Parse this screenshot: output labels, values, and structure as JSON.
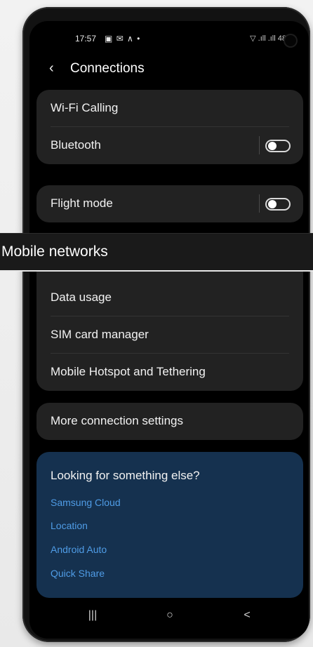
{
  "status_bar": {
    "time": "17:57",
    "left_icons": "▣ ✉ ∧ •",
    "right_icons": "▽ .ıll .ıll 48"
  },
  "header": {
    "back_icon": "chevron-left-icon",
    "title": "Connections"
  },
  "group_1": {
    "wifi_calling": "Wi-Fi Calling",
    "bluetooth": "Bluetooth",
    "bluetooth_on": false
  },
  "group_2": {
    "flight_mode": "Flight mode",
    "flight_mode_on": false
  },
  "banner": {
    "text": "Mobile networks"
  },
  "group_3": {
    "data_usage": "Data usage",
    "sim_card_manager": "SIM card manager",
    "hotspot": "Mobile Hotspot and Tethering"
  },
  "group_4": {
    "more_settings": "More connection settings"
  },
  "looking": {
    "title": "Looking for something else?",
    "links": [
      "Samsung Cloud",
      "Location",
      "Android Auto",
      "Quick Share"
    ]
  },
  "navbar": {
    "recents": "|||",
    "home": "○",
    "back": "<"
  },
  "colors": {
    "screen_bg": "#000000",
    "card_bg": "#222222",
    "suggestion_bg": "#15314f",
    "link": "#4f9ce6"
  }
}
